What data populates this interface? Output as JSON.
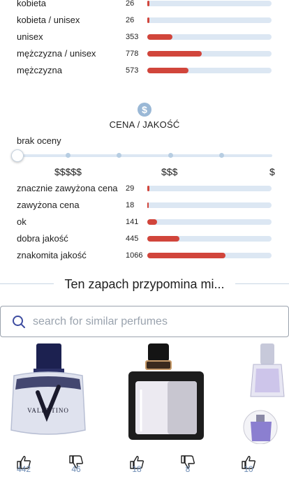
{
  "gender": {
    "rows": [
      {
        "label": "kobieta",
        "count": "26",
        "fill": 0.015
      },
      {
        "label": "kobieta / unisex",
        "count": "26",
        "fill": 0.015
      },
      {
        "label": "unisex",
        "count": "353",
        "fill": 0.2
      },
      {
        "label": "mężczyzna / unisex",
        "count": "778",
        "fill": 0.44
      },
      {
        "label": "mężczyzna",
        "count": "573",
        "fill": 0.33
      }
    ]
  },
  "price_quality": {
    "icon": "dollar-icon",
    "icon_glyph": "$",
    "title": "CENA / JAKOŚĆ",
    "slider_label": "brak oceny",
    "price_labels": [
      "$$$$$",
      "$$$",
      "$"
    ],
    "rows": [
      {
        "label": "znacznie zawyżona cena",
        "count": "29",
        "fill": 0.015
      },
      {
        "label": "zawyżona cena",
        "count": "18",
        "fill": 0.01
      },
      {
        "label": "ok",
        "count": "141",
        "fill": 0.08
      },
      {
        "label": "dobra jakość",
        "count": "445",
        "fill": 0.26
      },
      {
        "label": "znakomita jakość",
        "count": "1066",
        "fill": 0.63
      }
    ]
  },
  "similar": {
    "title": "Ten zapach przypomina mi...",
    "search_placeholder": "search for similar perfumes",
    "brand_text": "VALENTINO",
    "votes": [
      {
        "up": "442",
        "down": "46"
      },
      {
        "up": "18",
        "down": "8"
      },
      {
        "up": "10",
        "down": ""
      }
    ]
  },
  "colors": {
    "bar_fill": "#d1453b",
    "bar_track": "#dce7f3",
    "accent": "#6f8db5"
  }
}
